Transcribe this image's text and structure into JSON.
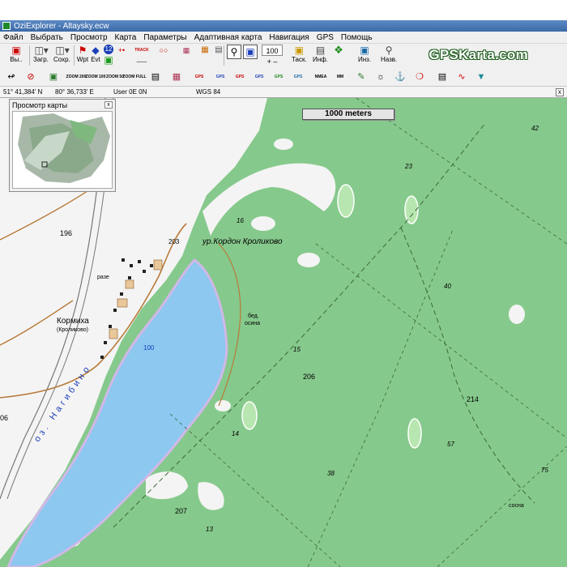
{
  "window": {
    "title": "OziExplorer - Altaysky.ecw"
  },
  "menu": [
    "Файл",
    "Выбрать",
    "Просмотр",
    "Карта",
    "Параметры",
    "Адаптивная карта",
    "Навигация",
    "GPS",
    "Помощь"
  ],
  "toolbar": {
    "exit_label": "Вы..",
    "load_label": "Загр.",
    "save_label": "Сохр.",
    "wpt_label": "Wpt",
    "evt_label": "Evt",
    "count_badge": "12",
    "track_label": "TRACK",
    "zoom_value": "100",
    "task_label": "Таск.",
    "info_label": "Инф.",
    "ins_label": "Инз.",
    "back_label": "Назв.",
    "brand": "GPSKarta.com"
  },
  "toolbar2": {
    "zoom_labels": [
      "ZOOM 200",
      "ZOOM 100",
      "ZOOM 50",
      "ZOOM FULL"
    ],
    "gps_labels": [
      "GPS",
      "GPS",
      "GPS",
      "GPS",
      "GPS",
      "GPS"
    ],
    "misc_labels": [
      "NMEA",
      "MM"
    ]
  },
  "status": {
    "lat": "51° 41,384' N",
    "lon": "80° 36,733' E",
    "user": "User  0E   0N",
    "datum": "WGS 84"
  },
  "scale": {
    "label": "1000 meters"
  },
  "overview": {
    "title": "Просмотр карты",
    "close": "x"
  },
  "map_labels": {
    "village": "ур.Кордон Кроликово",
    "town": "Кормиха",
    "town_sub": "(Кроликово)",
    "lake": "оз. Нагибино",
    "razez": "разе",
    "bed": "бед.",
    "osina": "осина",
    "sosna": "сосна",
    "e196": "196",
    "e203": "203",
    "e100": "100",
    "e206": "206",
    "e214": "214",
    "e207": "207",
    "e42": "42",
    "e23": "23",
    "e16": "16",
    "e40": "40",
    "e15": "15",
    "e14": "14",
    "e38": "38",
    "e57": "57",
    "e75": "75",
    "e13": "13",
    "e06": "06"
  },
  "colors": {
    "forest": "#86c98c",
    "field": "#f3f3f3",
    "water": "#8cc8f0",
    "road": "#b87a3a",
    "brand_text": "#ffffff"
  }
}
